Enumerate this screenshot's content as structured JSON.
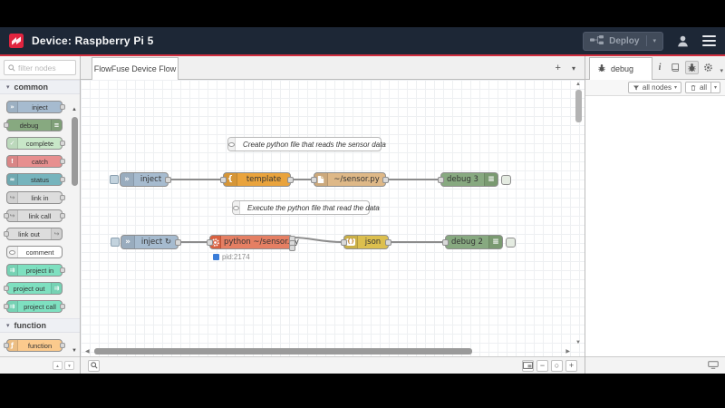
{
  "header": {
    "title": "Device: Raspberry Pi 5",
    "deploy": "Deploy"
  },
  "palette": {
    "filter_placeholder": "filter nodes",
    "categories": [
      {
        "label": "common",
        "items": [
          "inject",
          "debug",
          "complete",
          "catch",
          "status",
          "link in",
          "link call",
          "link out",
          "comment",
          "project in",
          "project out",
          "project call"
        ]
      },
      {
        "label": "function",
        "items": [
          "function"
        ]
      }
    ]
  },
  "workspace": {
    "tab": "FlowFuse Device Flow",
    "comments": [
      "Create python file that reads the sensor data",
      "Execute the python file that read the data"
    ],
    "nodes": {
      "inject1": "inject",
      "template": "template",
      "file": "~/sensor.py",
      "debug3": "debug 3",
      "inject2": "inject ↻",
      "exec": "python ~/sensor.py",
      "json": "json",
      "debug2": "debug 2"
    },
    "exec_status": "pid:2174"
  },
  "sidebar": {
    "tab": "debug",
    "filter_label": "all nodes",
    "clear_label": "all"
  },
  "icons": {
    "caret": "▾",
    "chevron_down": "▾",
    "plus": "+",
    "minus": "−",
    "zoom_reset": "○",
    "up_arrow": "▲",
    "down_arrow": "▼",
    "left_arrow": "◀",
    "right_arrow": "▶",
    "inject": "»",
    "debug": "≡",
    "complete": "✓",
    "catch": "!",
    "status": "≈",
    "link": "↪",
    "project": "⇉",
    "function": "ƒ",
    "template": "{",
    "json": "{}",
    "info": "i"
  },
  "colors": {
    "header_bg": "#1d2736",
    "accent_red": "#d12e3e",
    "inject": "#a6bbcf",
    "debug": "#87a980",
    "debug_band": "#7a9a71",
    "complete": "#c8e7c8",
    "catch": "#e78f8f",
    "status": "#76b4bd",
    "link": "#dddddd",
    "comment": "#ffffff",
    "project": "#7ee0c0",
    "function": "#fbca8d",
    "template": "#e9a33c",
    "file": "#deb887",
    "exec": "#e57f63",
    "exec_band": "#d8603f",
    "json": "#dcbf4e",
    "status_dot": "#3b7dd8"
  }
}
